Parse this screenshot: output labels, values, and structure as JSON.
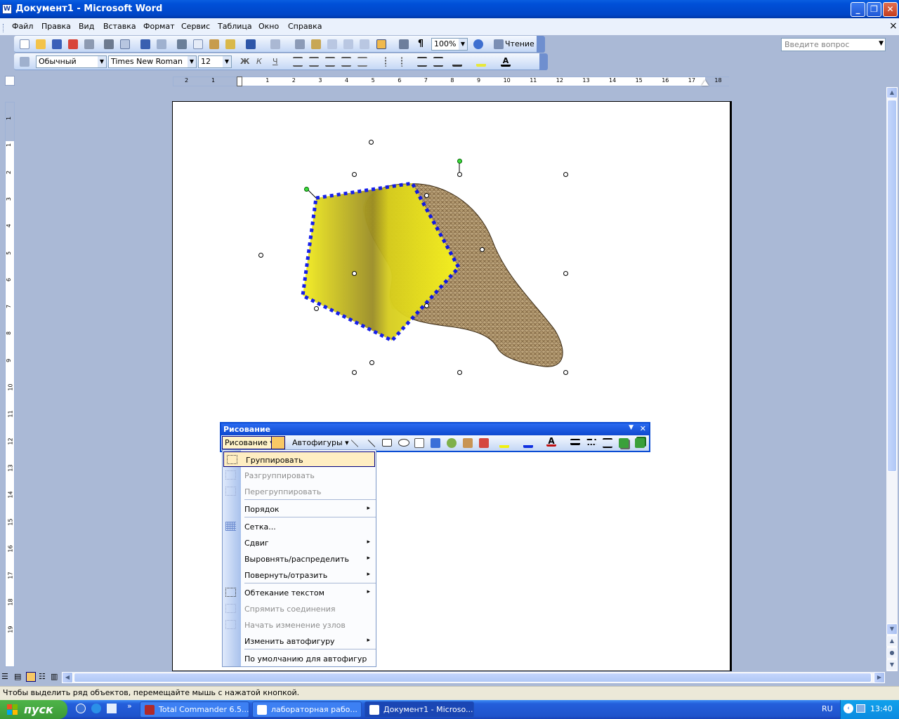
{
  "window": {
    "title": "Документ1 - Microsoft Word",
    "icon": "W"
  },
  "window_buttons": [
    "_",
    "❐",
    "✕"
  ],
  "menubar": {
    "items": [
      "Файл",
      "Правка",
      "Вид",
      "Вставка",
      "Формат",
      "Сервис",
      "Таблица",
      "Окно",
      "Справка"
    ],
    "ask_placeholder": "Введите вопрос",
    "close": "×"
  },
  "standard_toolbar": {
    "zoom": "100%",
    "reading": "Чтение"
  },
  "format_toolbar": {
    "style": "Обычный",
    "font": "Times New Roman",
    "size": "12",
    "bold": "Ж",
    "italic": "К",
    "underline": "Ч"
  },
  "ruler_labels": [
    "2",
    "1",
    "1",
    "2",
    "3",
    "4",
    "5",
    "6",
    "7",
    "8",
    "9",
    "10",
    "11",
    "12",
    "13",
    "14",
    "15",
    "16",
    "17",
    "18"
  ],
  "vruler_labels": [
    "1",
    "1",
    "2",
    "3",
    "4",
    "5",
    "6",
    "7",
    "8",
    "9",
    "10",
    "11",
    "12",
    "13",
    "14",
    "15",
    "16",
    "17",
    "18",
    "19"
  ],
  "drawing_toolbar": {
    "title": "Рисование",
    "draw_menu": "Рисование",
    "autoshapes": "Автофигуры",
    "close": "✕",
    "dropdown": "▼"
  },
  "context_menu": {
    "items": [
      {
        "label": "Группировать",
        "icon": "group-icon",
        "enabled": true,
        "submenu": false,
        "highlighted": true
      },
      {
        "label": "Разгруппировать",
        "icon": "ungroup-icon",
        "enabled": false,
        "submenu": false
      },
      {
        "label": "Перегруппировать",
        "icon": "regroup-icon",
        "enabled": false,
        "submenu": false
      },
      {
        "label": "Порядок",
        "enabled": true,
        "submenu": true
      },
      {
        "label": "Сетка...",
        "icon": "grid-icon",
        "enabled": true,
        "submenu": false
      },
      {
        "label": "Сдвиг",
        "enabled": true,
        "submenu": true
      },
      {
        "label": "Выровнять/распределить",
        "enabled": true,
        "submenu": true
      },
      {
        "label": "Повернуть/отразить",
        "enabled": true,
        "submenu": true
      },
      {
        "label": "Обтекание текстом",
        "icon": "wrap-text-icon",
        "enabled": true,
        "submenu": true
      },
      {
        "label": "Спрямить соединения",
        "icon": "reroute-icon",
        "enabled": false,
        "submenu": false
      },
      {
        "label": "Начать изменение узлов",
        "icon": "edit-points-icon",
        "enabled": false,
        "submenu": false
      },
      {
        "label": "Изменить автофигуру",
        "enabled": true,
        "submenu": true
      },
      {
        "label": "По умолчанию для автофигур",
        "enabled": true,
        "submenu": false
      }
    ],
    "submenu_arrow": "▸"
  },
  "statusbar": {
    "text": "Чтобы выделить ряд объектов, перемещайте мышь с нажатой кнопкой."
  },
  "taskbar": {
    "start": "пуск",
    "tasks": [
      "Total Commander 6.5...",
      "лабораторная рабо...",
      "Документ1 - Microso..."
    ],
    "active_task": 2,
    "overflow": "»",
    "language": "RU",
    "clock": "13:40"
  },
  "colors": {
    "titlebar": "#0050d8",
    "selection": "#0000ff",
    "yellow_shape": "#f4ec1c",
    "burlap": "#a98c62",
    "menu_highlight": "#ffeec2"
  }
}
